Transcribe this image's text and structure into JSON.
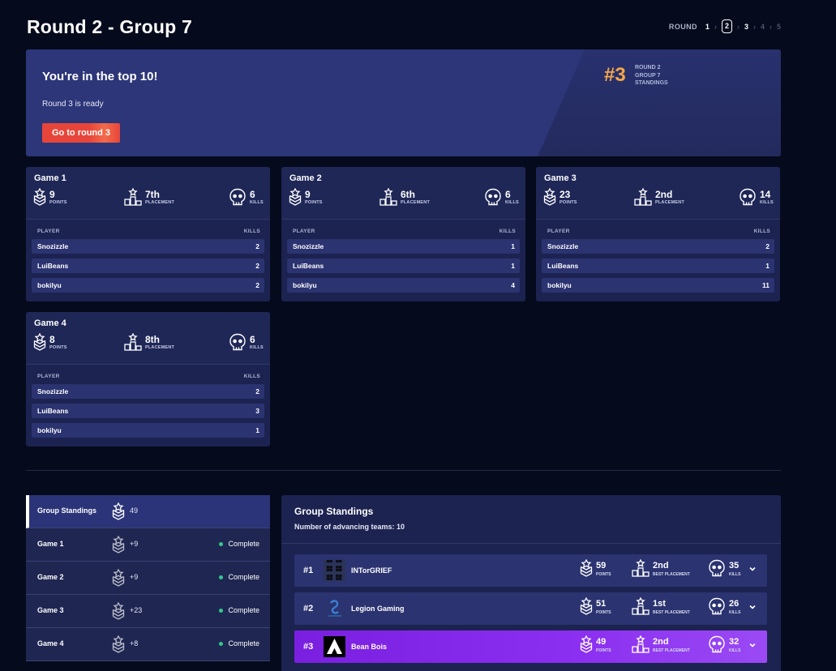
{
  "page": {
    "title": "Round 2 - Group 7"
  },
  "round_nav": {
    "label": "ROUND",
    "rounds": [
      "1",
      "2",
      "3",
      "4",
      "5"
    ]
  },
  "banner": {
    "title": "You're in the top 10!",
    "subtitle": "Round 3 is ready",
    "button_label": "Go to round 3",
    "rank": "#3",
    "meta": [
      "ROUND 2",
      "GROUP 7",
      "STANDINGS"
    ],
    "accent": "#f5a64a",
    "button_color": "#e8453a"
  },
  "labels": {
    "points": "POINTS",
    "placement": "PLACEMENT",
    "kills": "KILLS",
    "player": "PLAYER",
    "best_placement": "BEST PLACEMENT"
  },
  "games": [
    {
      "title": "Game 1",
      "points": "9",
      "placement": "7th",
      "kills": "6",
      "players": [
        {
          "name": "Snozizzle",
          "kills": "2"
        },
        {
          "name": "LuiBeans",
          "kills": "2"
        },
        {
          "name": "bokilyu",
          "kills": "2"
        }
      ]
    },
    {
      "title": "Game 2",
      "points": "9",
      "placement": "6th",
      "kills": "6",
      "players": [
        {
          "name": "Snozizzle",
          "kills": "1"
        },
        {
          "name": "LuiBeans",
          "kills": "1"
        },
        {
          "name": "bokilyu",
          "kills": "4"
        }
      ]
    },
    {
      "title": "Game 3",
      "points": "23",
      "placement": "2nd",
      "kills": "14",
      "players": [
        {
          "name": "Snozizzle",
          "kills": "2"
        },
        {
          "name": "LuiBeans",
          "kills": "1"
        },
        {
          "name": "bokilyu",
          "kills": "11"
        }
      ]
    },
    {
      "title": "Game 4",
      "points": "8",
      "placement": "8th",
      "kills": "6",
      "players": [
        {
          "name": "Snozizzle",
          "kills": "2"
        },
        {
          "name": "LuiBeans",
          "kills": "3"
        },
        {
          "name": "bokilyu",
          "kills": "1"
        }
      ]
    }
  ],
  "side_nav": {
    "items": [
      {
        "label": "Group Standings",
        "value": "49",
        "status": ""
      },
      {
        "label": "Game 1",
        "value": "+9",
        "status": "Complete"
      },
      {
        "label": "Game 2",
        "value": "+9",
        "status": "Complete"
      },
      {
        "label": "Game 3",
        "value": "+23",
        "status": "Complete"
      },
      {
        "label": "Game 4",
        "value": "+8",
        "status": "Complete"
      }
    ],
    "status_color": "#35c88d"
  },
  "standings": {
    "title": "Group Standings",
    "subtitle": "Number of advancing teams: 10",
    "teams": [
      {
        "rank": "#1",
        "name": "INTorGRIEF",
        "points": "59",
        "best_placement": "2nd",
        "kills": "35",
        "logo": "pixel-logo"
      },
      {
        "rank": "#2",
        "name": "Legion Gaming",
        "points": "51",
        "best_placement": "1st",
        "kills": "26",
        "logo": "legion-logo"
      },
      {
        "rank": "#3",
        "name": "Bean Bois",
        "points": "49",
        "best_placement": "2nd",
        "kills": "32",
        "logo": "apex-logo"
      }
    ],
    "highlight_color": "#8b2ff0"
  }
}
